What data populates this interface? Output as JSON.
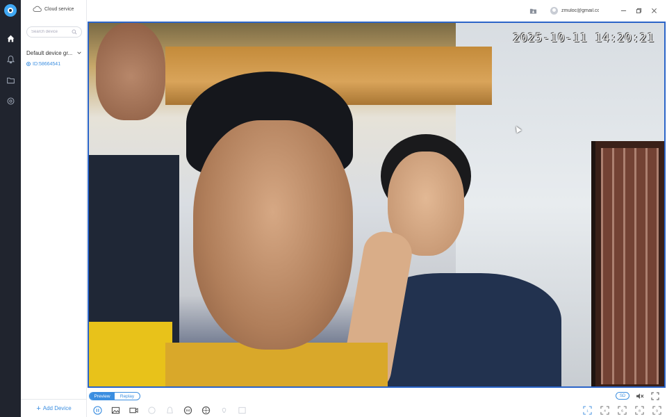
{
  "app": {
    "colors": {
      "rail": "#20242e",
      "accent": "#3b8ee0",
      "video_border": "#2a64c8"
    }
  },
  "rail": {
    "items": [
      {
        "name": "home-icon"
      },
      {
        "name": "bell-icon"
      },
      {
        "name": "folder-icon"
      },
      {
        "name": "settings-icon"
      }
    ]
  },
  "topbar": {
    "cloud_label": "Cloud service",
    "user_email": "zmuloc@gmail.co"
  },
  "sidebar": {
    "search_placeholder": "Search device",
    "group_label": "Default device gr...",
    "device_label": "ID:58664541",
    "add_device_label": "Add Device"
  },
  "video": {
    "timestamp": "2025-10-11 14:20:21"
  },
  "bottom": {
    "tab_preview": "Preview",
    "tab_replay": "Replay",
    "quality_label": "SD",
    "right_buttons": [
      "1",
      "4",
      "6",
      "8",
      "9",
      "16"
    ]
  }
}
